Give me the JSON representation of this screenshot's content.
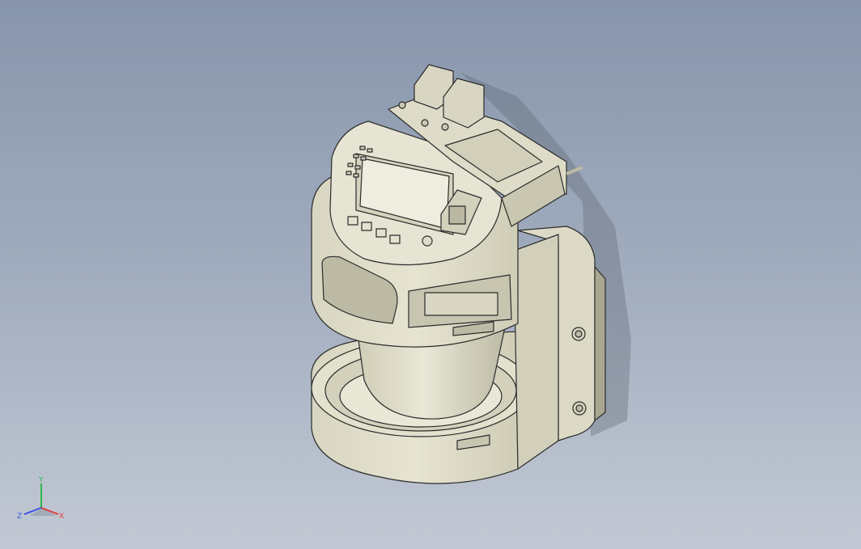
{
  "viewport": {
    "background_top": "#8795ab",
    "background_bottom": "#c2c9d4",
    "model_color": "#e2e0cc",
    "model_shade": "#c9c7b1",
    "edge_color": "#2b2b2b",
    "screen_color": "#ecebdf"
  },
  "triad": {
    "x_label": "X",
    "y_label": "Y",
    "z_label": "Z",
    "x_color": "#e23b3b",
    "y_color": "#2fb84a",
    "z_color": "#3b4fe2"
  }
}
